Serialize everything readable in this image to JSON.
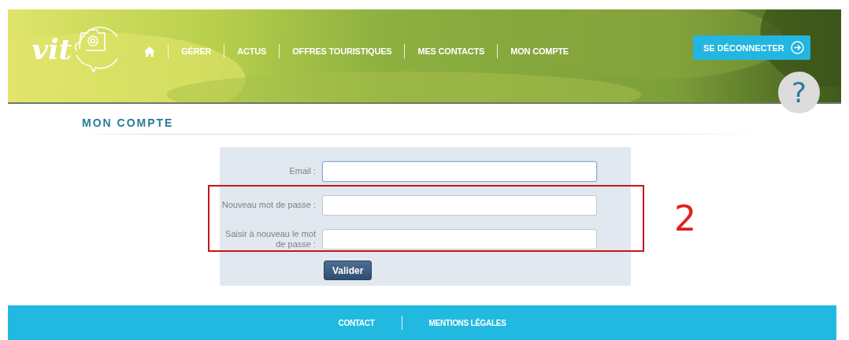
{
  "header": {
    "logo": "vit",
    "nav": [
      {
        "kind": "home"
      },
      {
        "kind": "link",
        "label": "GÉRER"
      },
      {
        "kind": "link",
        "label": "ACTUS"
      },
      {
        "kind": "link",
        "label": "OFFRES TOURISTIQUES"
      },
      {
        "kind": "link",
        "label": "MES CONTACTS"
      },
      {
        "kind": "link",
        "label": "MON COMPTE"
      }
    ],
    "logout": "SE DÉCONNECTER",
    "help": "?"
  },
  "page_title": "MON COMPTE",
  "form": {
    "fields": [
      {
        "label": "Email :",
        "focused": true
      },
      {
        "label": "Nouveau mot de passe :",
        "focused": false
      },
      {
        "label": "Saisir à nouveau le mot de passe :",
        "focused": false
      }
    ],
    "submit": "Valider"
  },
  "annotation": {
    "label": "2"
  },
  "footer": {
    "links": [
      "CONTACT",
      "MENTIONS LÉGALES"
    ]
  }
}
